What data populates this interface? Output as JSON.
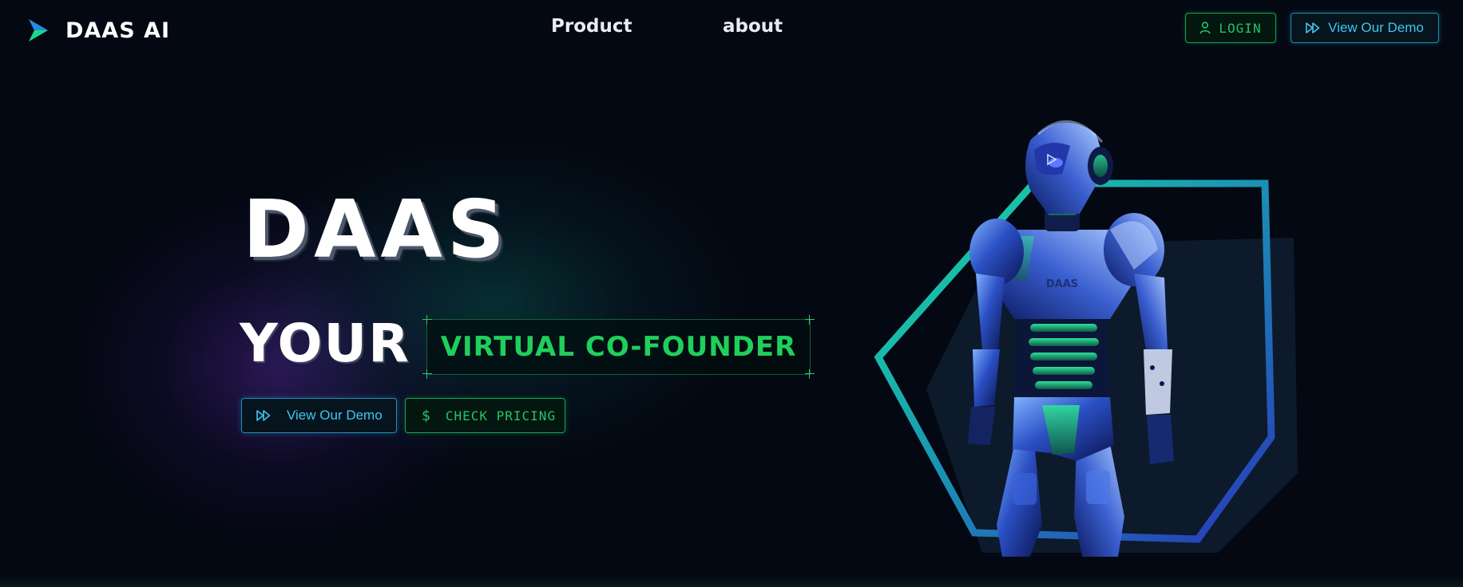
{
  "brand": {
    "name": "DAAS AI",
    "logo_icon": "play-triangle-logo-icon"
  },
  "nav": {
    "items": [
      {
        "label": "Product"
      },
      {
        "label": "about"
      }
    ]
  },
  "header_actions": {
    "login_label": "LOGIN",
    "login_icon": "user-icon",
    "demo_label": "View Our Demo",
    "demo_icon": "fast-forward-icon"
  },
  "hero": {
    "title": "DAAS",
    "line2_prefix": "YOUR",
    "line2_highlight": "VIRTUAL CO-FOUNDER",
    "demo_button_label": "View Our Demo",
    "pricing_button_label": "CHECK PRICING",
    "pricing_icon": "$"
  },
  "illustration": {
    "robot_chest_text": "DAAS",
    "frame_colors": [
      "#17e3a0",
      "#2a35b8"
    ]
  },
  "colors": {
    "background": "#040812",
    "accent_green": "#22c66a",
    "accent_cyan": "#3fc6ee",
    "highlight_green": "#1fcf5c"
  }
}
